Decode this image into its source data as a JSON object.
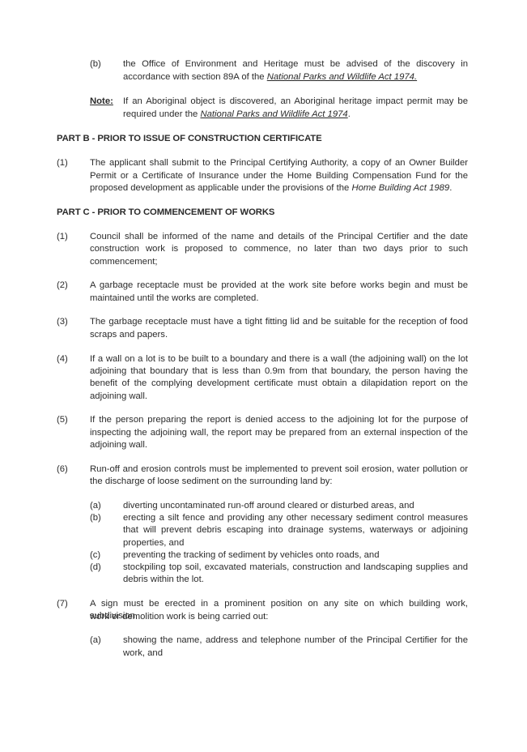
{
  "part_a_tail": {
    "item_b": {
      "label": "(b)",
      "line1": "the Office of Environment and Heritage must be advised of the discovery in",
      "line2_prefix": "accordance with section 89A of the ",
      "line2_act": "National Parks and Wildlife Act 1974."
    },
    "note": {
      "label": "Note:",
      "line1": "If an Aboriginal object is discovered, an Aboriginal heritage impact permit may be",
      "line2_prefix": "required under the ",
      "line2_act": "National Parks and Wildlife Act 1974",
      "line2_suffix": "."
    }
  },
  "part_b": {
    "heading": "PART B - PRIOR TO ISSUE OF CONSTRUCTION CERTIFICATE",
    "items": [
      {
        "label": "(1)",
        "line1": "The applicant shall submit to the Principal Certifying Authority, a copy of an Owner Builder",
        "line2": "Permit or a Certificate of Insurance under the Home Building Compensation Fund for the",
        "line3_prefix": "proposed development as applicable under the provisions of the ",
        "line3_act": "Home Building Act 1989",
        "line3_suffix": "."
      }
    ]
  },
  "part_c": {
    "heading": "PART C - PRIOR TO COMMENCEMENT OF WORKS",
    "items": [
      {
        "label": "(1)",
        "lines": [
          "Council shall be informed of the name and details of the Principal Certifier and the date",
          "construction work is proposed to commence, no later than two days prior to such",
          "commencement;"
        ]
      },
      {
        "label": "(2)",
        "lines": [
          "A garbage receptacle must be provided at the work site before works begin and must be",
          "maintained until the works are completed."
        ]
      },
      {
        "label": "(3)",
        "lines": [
          "The garbage receptacle must have a tight fitting lid and be suitable for the reception of food",
          "scraps and papers."
        ]
      },
      {
        "label": "(4)",
        "lines": [
          "If a wall on a lot is to be built to a boundary and there is a wall (the adjoining wall) on the lot",
          "adjoining that boundary that is less than 0.9m from that boundary, the person having the",
          "benefit of the complying development certificate must obtain a dilapidation report on the",
          "adjoining wall."
        ]
      },
      {
        "label": "(5)",
        "lines": [
          "If the person preparing the report is denied access to the adjoining lot for the purpose of",
          "inspecting the adjoining wall, the report may be prepared from an external inspection of the",
          "adjoining wall."
        ]
      },
      {
        "label": "(6)",
        "lines": [
          "Run-off and erosion controls must be implemented to prevent soil erosion, water pollution or",
          "the discharge of loose sediment on the surrounding land by:"
        ],
        "subitems": [
          {
            "label": "(a)",
            "lines": [
              "diverting uncontaminated run-off around cleared or disturbed areas, and"
            ]
          },
          {
            "label": "(b)",
            "lines": [
              "erecting a silt fence and providing any other necessary sediment control measures",
              "that will prevent debris escaping into drainage systems, waterways or adjoining",
              "properties, and"
            ]
          },
          {
            "label": "(c)",
            "lines": [
              "preventing the tracking of sediment by vehicles onto roads, and"
            ]
          },
          {
            "label": "(d)",
            "lines": [
              "stockpiling top soil, excavated materials, construction and landscaping supplies and",
              "debris within the lot."
            ]
          }
        ]
      },
      {
        "label": "(7)",
        "lines": [
          "A sign must be erected in a prominent position on any site on which building work, subdivision",
          "work or demolition work is being carried out:"
        ],
        "subitems": [
          {
            "label": "(a)",
            "lines": [
              "showing the name, address and telephone number of the Principal Certifier for the",
              "work, and"
            ]
          }
        ]
      }
    ]
  }
}
